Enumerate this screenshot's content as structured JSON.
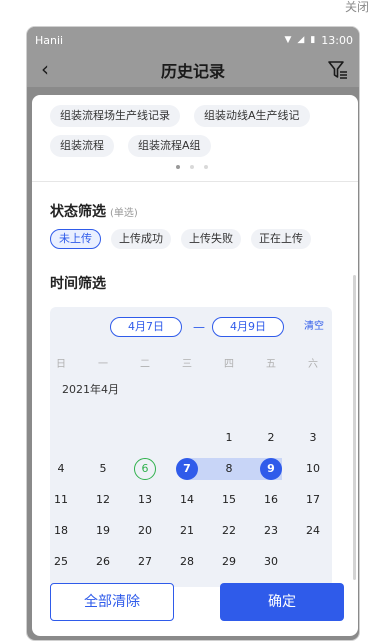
{
  "window": {
    "close_label": "关闭"
  },
  "statusbar": {
    "carrier": "Hanii",
    "time": "13:00"
  },
  "navbar": {
    "title": "历史记录"
  },
  "lines": {
    "items": [
      {
        "label": "组装流程场生产线记录"
      },
      {
        "label": "组装动线A生产线记"
      },
      {
        "label": "组装流程"
      },
      {
        "label": "组装流程A组"
      }
    ],
    "page_count": 3,
    "active_page": 0
  },
  "status_filter": {
    "title": "状态筛选",
    "hint": "(单选)",
    "options": [
      {
        "label": "未上传",
        "selected": true
      },
      {
        "label": "上传成功",
        "selected": false
      },
      {
        "label": "上传失败",
        "selected": false
      },
      {
        "label": "正在上传",
        "selected": false
      }
    ]
  },
  "time_filter": {
    "title": "时间筛选",
    "start": "4月7日",
    "separator": "—",
    "end": "4月9日",
    "clear_label": "清空",
    "weekdays": [
      "日",
      "一",
      "二",
      "三",
      "四",
      "五",
      "六"
    ],
    "month": "2021年4月",
    "days_in_month": 30,
    "first_weekday": 4,
    "today": 6,
    "range_start": 7,
    "range_end": 9
  },
  "actions": {
    "clear_all": "全部清除",
    "confirm": "确定"
  },
  "colors": {
    "accent": "#2f5bea",
    "today": "#2fb14c",
    "range": "#c8d5f7"
  }
}
